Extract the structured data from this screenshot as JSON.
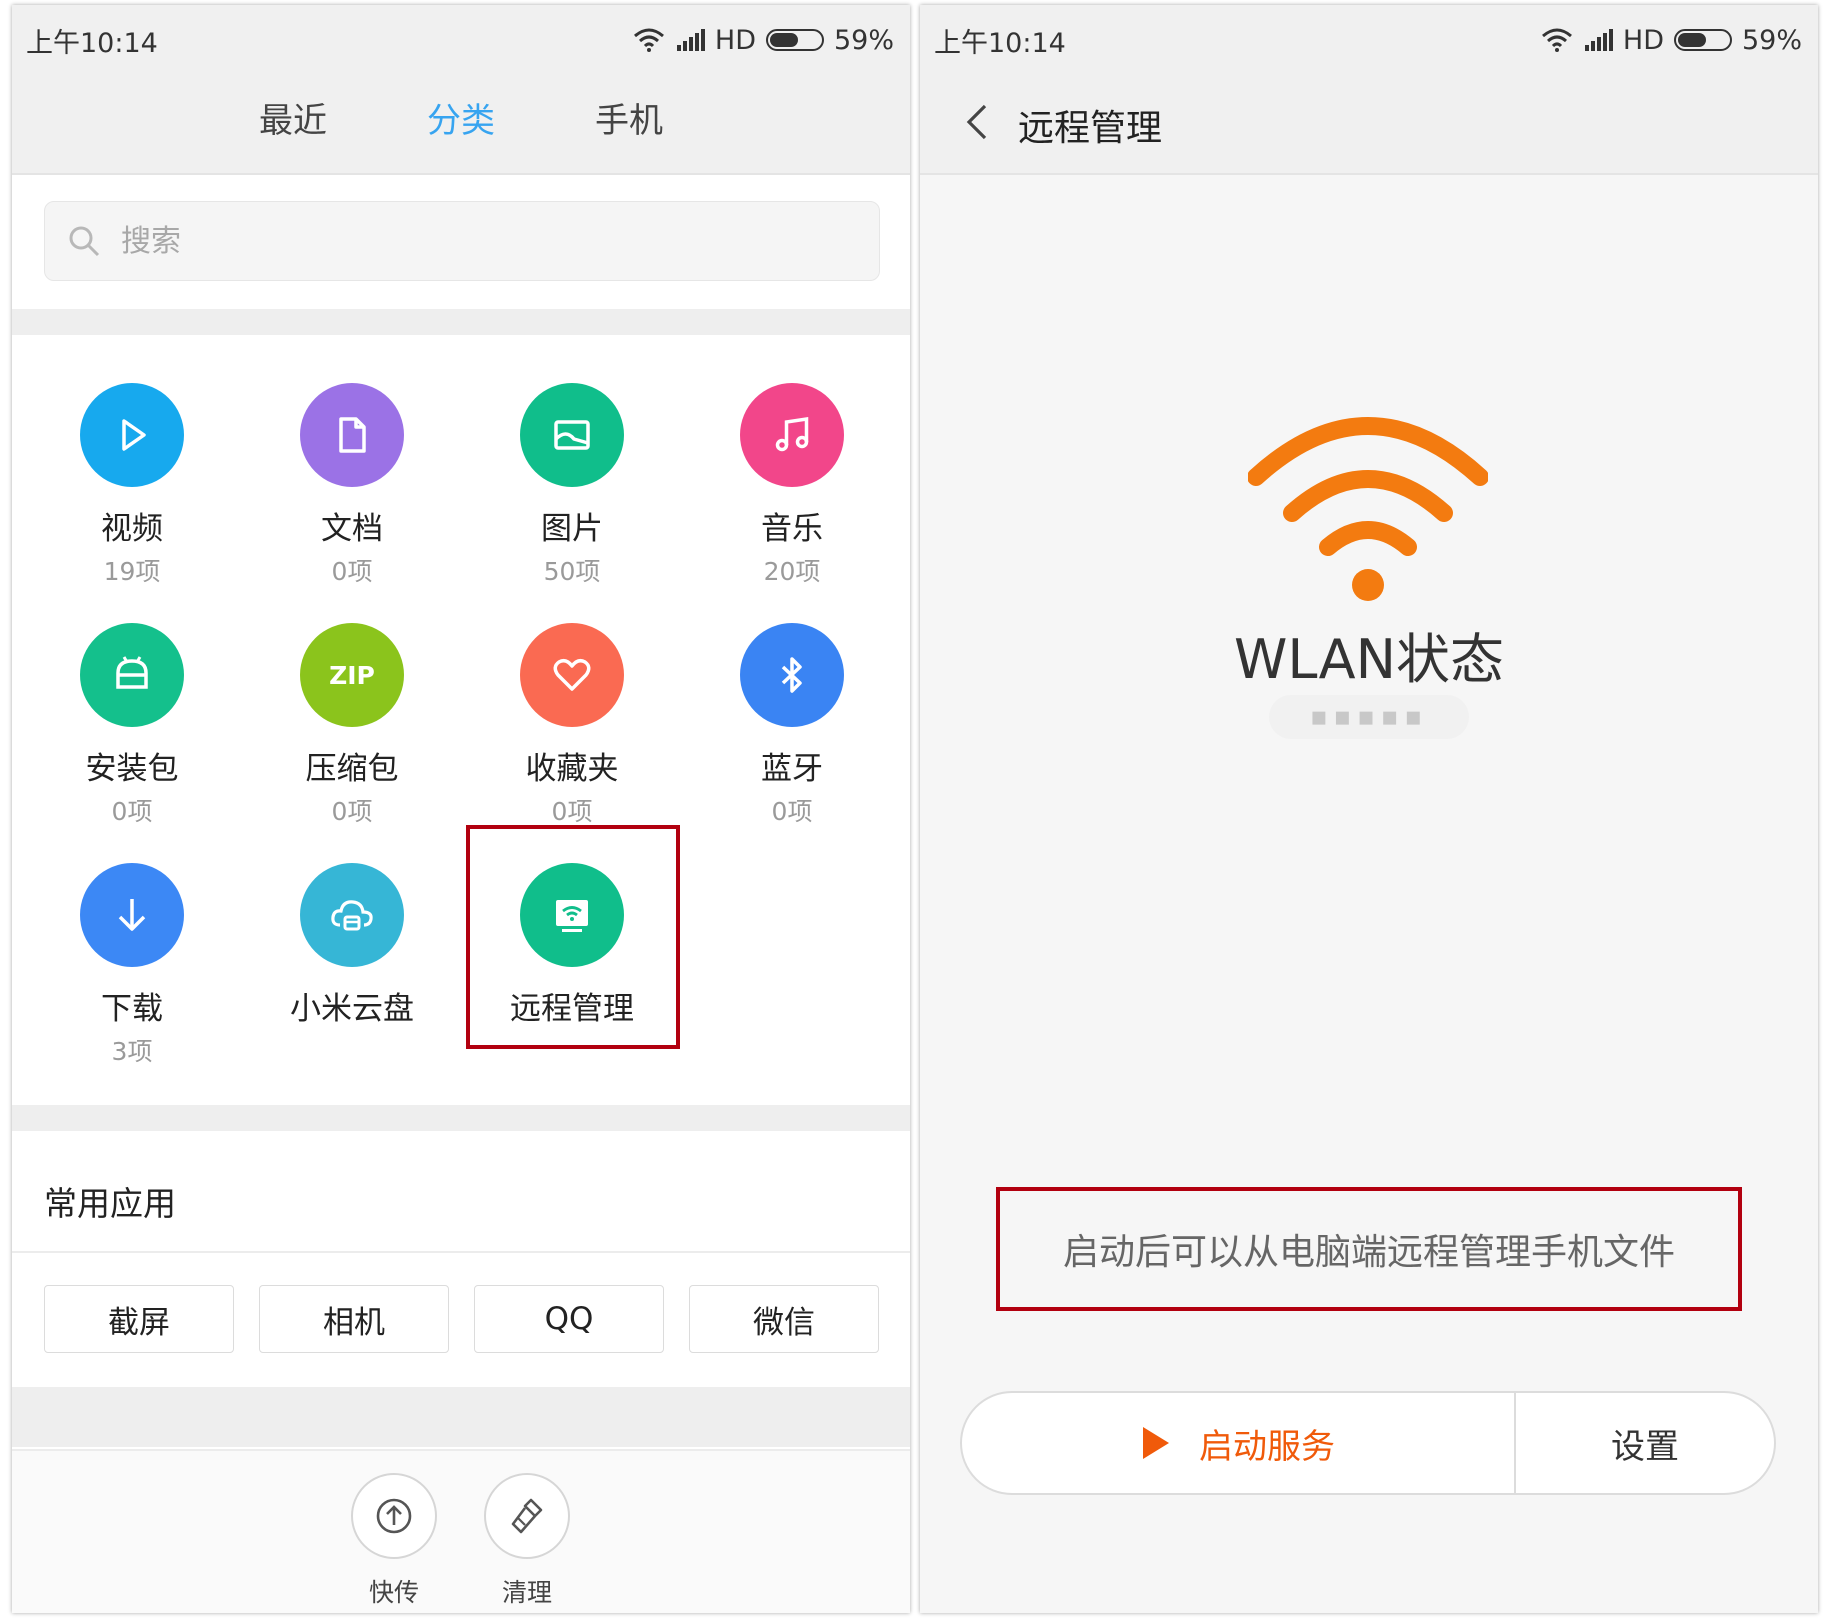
{
  "left_screen": {
    "status_bar": {
      "time": "上午10:14",
      "network": "HD",
      "battery": "59%",
      "battery_level": 0.59
    },
    "tabs": [
      {
        "label": "最近",
        "active": false
      },
      {
        "label": "分类",
        "active": true
      },
      {
        "label": "手机",
        "active": false
      }
    ],
    "search": {
      "placeholder": "搜索",
      "value": ""
    },
    "categories": [
      {
        "name": "视频",
        "count": "19项",
        "icon": "play-icon",
        "color": "#17a9ee"
      },
      {
        "name": "文档",
        "count": "0项",
        "icon": "document-icon",
        "color": "#9b72e6"
      },
      {
        "name": "图片",
        "count": "50项",
        "icon": "image-icon",
        "color": "#10be8b"
      },
      {
        "name": "音乐",
        "count": "20项",
        "icon": "music-icon",
        "color": "#f2468a"
      },
      {
        "name": "安装包",
        "count": "0项",
        "icon": "package-icon",
        "color": "#14c08c"
      },
      {
        "name": "压缩包",
        "count": "0项",
        "icon": "zip-icon",
        "icon_text": "ZIP",
        "color": "#8bc41c"
      },
      {
        "name": "收藏夹",
        "count": "0项",
        "icon": "heart-icon",
        "color": "#fa6a52"
      },
      {
        "name": "蓝牙",
        "count": "0项",
        "icon": "bluetooth-icon",
        "color": "#3a84f3"
      },
      {
        "name": "下载",
        "count": "3项",
        "icon": "download-icon",
        "color": "#3c88f5"
      },
      {
        "name": "小米云盘",
        "count": "",
        "icon": "cloud-drive-icon",
        "color": "#36b6d6"
      },
      {
        "name": "远程管理",
        "count": "",
        "icon": "remote-manage-icon",
        "color": "#10be8b"
      }
    ],
    "common_apps": {
      "title": "常用应用",
      "items": [
        "截屏",
        "相机",
        "QQ",
        "微信"
      ]
    },
    "tools": [
      {
        "label": "快传",
        "icon": "upload-icon"
      },
      {
        "label": "清理",
        "icon": "broom-icon"
      }
    ]
  },
  "right_screen": {
    "status_bar": {
      "time": "上午10:14",
      "network": "HD",
      "battery": "59%",
      "battery_level": 0.59
    },
    "title": "远程管理",
    "wlan_title": "WLAN状态",
    "ssid": "▪︎▪︎▪︎▪︎▪︎",
    "hint": "启动后可以从电脑端远程管理手机文件",
    "start_button": "启动服务",
    "settings_button": "设置",
    "accent_color": "#f37b10"
  }
}
